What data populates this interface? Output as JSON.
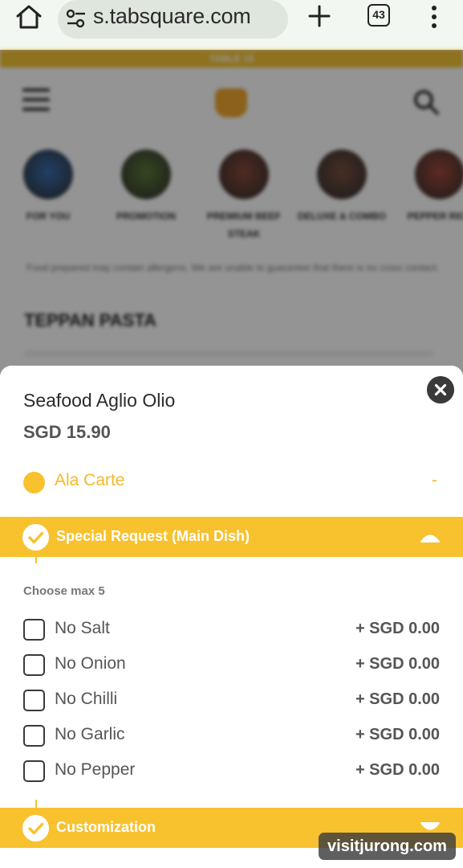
{
  "browser": {
    "url": "s.tabsquare.com",
    "tab_count": "43"
  },
  "background_page": {
    "table_banner": "TABLE 15",
    "categories": [
      {
        "label": "FOR YOU",
        "color": "#3a6fb0"
      },
      {
        "label": "PROMOTION",
        "color": "#5a7a3a"
      },
      {
        "label": "PREMIUM BEEF STEAK",
        "color": "#8a4a3a"
      },
      {
        "label": "DELUXE & COMBO",
        "color": "#7a5040"
      },
      {
        "label": "PEPPER RICE",
        "color": "#a04a3a"
      }
    ],
    "allergen_notice": "Food prepared may contain allergens. We are unable to guarantee that there is no cross contact.",
    "section_title": "TEPPAN PASTA"
  },
  "item": {
    "name": "Seafood Aglio Olio",
    "price": "SGD 15.90",
    "variant_label": "Ala Carte",
    "variant_value": "-"
  },
  "special_request": {
    "title": "Special Request (Main Dish)",
    "choose_max": "Choose max 5",
    "options": [
      {
        "name": "No Salt",
        "price": "+ SGD 0.00"
      },
      {
        "name": "No Onion",
        "price": "+ SGD 0.00"
      },
      {
        "name": "No Chilli",
        "price": "+ SGD 0.00"
      },
      {
        "name": "No Garlic",
        "price": "+ SGD 0.00"
      },
      {
        "name": "No Pepper",
        "price": "+ SGD 0.00"
      }
    ]
  },
  "customization": {
    "title": "Customization"
  },
  "watermark": "visitjurong.com",
  "colors": {
    "accent": "#f8c12e",
    "accent_text": "#f5b92a",
    "close_button": "#3a3a3a"
  }
}
